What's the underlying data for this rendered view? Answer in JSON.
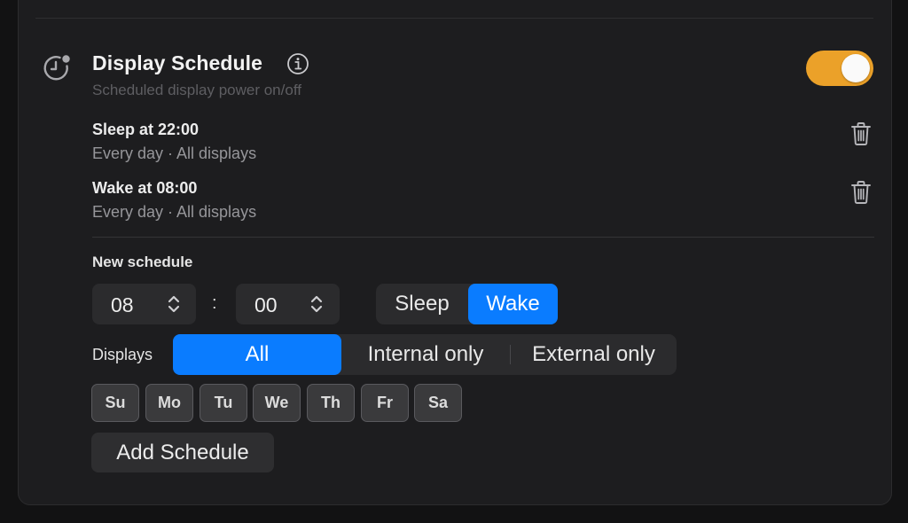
{
  "header": {
    "title": "Display Schedule",
    "subtitle": "Scheduled display power on/off",
    "toggle_on": true,
    "accent_color": "#eba129"
  },
  "schedules": [
    {
      "title": "Sleep at 22:00",
      "details": "Every day · All displays"
    },
    {
      "title": "Wake at 08:00",
      "details": "Every day · All displays"
    }
  ],
  "new_schedule": {
    "label": "New schedule",
    "hour": "08",
    "separator": ":",
    "minute": "00",
    "action_options": [
      "Sleep",
      "Wake"
    ],
    "action_selected": "Wake",
    "displays_label": "Displays",
    "display_options": [
      "All",
      "Internal only",
      "External only"
    ],
    "display_selected": "All",
    "days": [
      "Su",
      "Mo",
      "Tu",
      "We",
      "Th",
      "Fr",
      "Sa"
    ],
    "add_button": "Add Schedule",
    "selection_color": "#0a7cff"
  },
  "icons": {
    "schedule": "clock-badge-icon",
    "info": "info-circle-icon",
    "delete": "trash-icon",
    "stepper": "chevron-up-down-icon"
  }
}
